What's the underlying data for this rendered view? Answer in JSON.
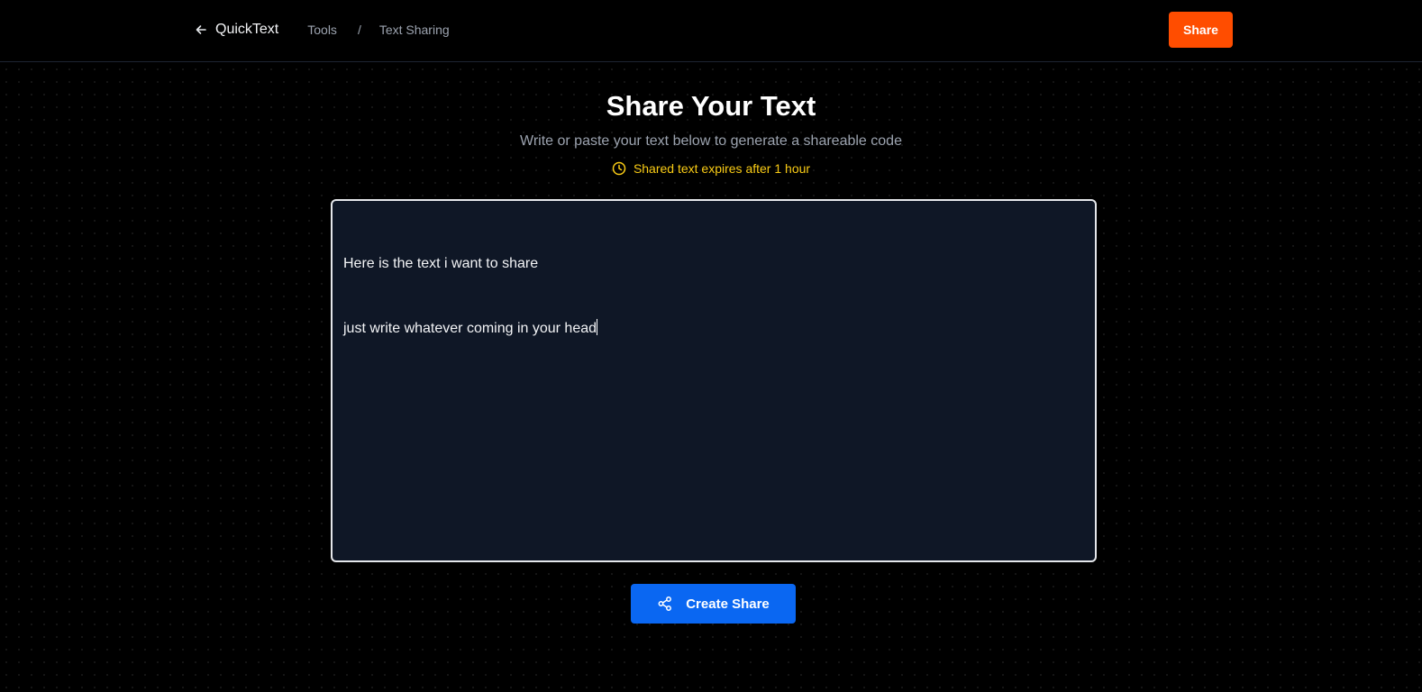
{
  "nav": {
    "brand": "QuickText",
    "breadcrumb_tools": "Tools",
    "breadcrumb_separator": "/",
    "breadcrumb_current": "Text Sharing",
    "share_label": "Share",
    "share_color": "#ff4d00"
  },
  "main": {
    "title": "Share Your Text",
    "subtitle": "Write or paste your text below to generate a shareable code",
    "expiry_text": "Shared text expires after 1 hour",
    "expiry_color": "#facc15",
    "editor_line_1": "Here is the text i want to share",
    "editor_line_2": "just write whatever coming in your head",
    "create_label": "Create Share",
    "create_color": "#0a67f2"
  },
  "icons": {
    "back": "arrow-left-icon",
    "expiry": "clock-icon",
    "create": "share-icon"
  }
}
